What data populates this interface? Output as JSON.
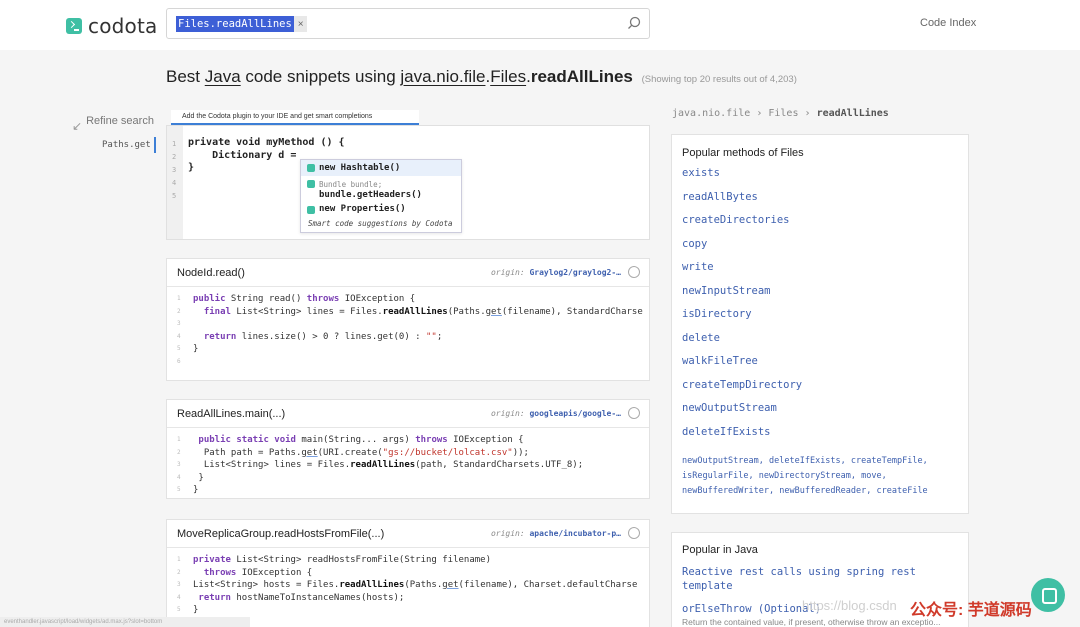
{
  "header": {
    "brand": "codota",
    "search_chip": "Files.readAllLines",
    "chip_close": "×",
    "code_index": "Code Index"
  },
  "page": {
    "title_prefix": "Best ",
    "title_lang": "Java",
    "title_mid": " code snippets using ",
    "title_pkg": "java.nio.file",
    "title_dot1": ".",
    "title_class": "Files",
    "title_dot2": ".",
    "title_method": "readAllLines",
    "results_note": "(Showing top 20 results out of 4,203)"
  },
  "refine": {
    "label": "Refine search",
    "items": [
      "Paths.get"
    ]
  },
  "editor": {
    "plugin_tab": "Add the Codota plugin to your IDE and get smart completions",
    "line_numbers": [
      "1",
      "2",
      "3",
      "4",
      "5"
    ],
    "code": "private void myMethod () {\n    Dictionary d =\n}",
    "suggestions": {
      "s1": "new Hashtable()",
      "s2_hint": "Bundle bundle;",
      "s2": "bundle.getHeaders()",
      "s3": "new Properties()",
      "footer": "Smart code suggestions by Codota"
    }
  },
  "cards": [
    {
      "title": "NodeId.read()",
      "origin_label": "origin:",
      "origin": "Graylog2/graylog2-…"
    },
    {
      "title": "ReadAllLines.main(...)",
      "origin_label": "origin:",
      "origin": "googleapis/google-…"
    },
    {
      "title": "MoveReplicaGroup.readHostsFromFile(...)",
      "origin_label": "origin:",
      "origin": "apache/incubator-p…"
    }
  ],
  "breadcrumb": {
    "pkg": "java.nio.file",
    "sep1": "›",
    "cls": "Files",
    "sep2": "›",
    "method": "readAllLines"
  },
  "popular_methods": {
    "title": "Popular methods of Files",
    "items": [
      "exists",
      "readAllBytes",
      "createDirectories",
      "copy",
      "write",
      "newInputStream",
      "isDirectory",
      "delete",
      "walkFileTree",
      "createTempDirectory",
      "newOutputStream",
      "deleteIfExists"
    ],
    "more": [
      "newOutputStream",
      "deleteIfExists",
      "createTempFile",
      "isRegularFile",
      "newDirectoryStream",
      "move",
      "newBufferedWriter",
      "newBufferedReader",
      "createFile"
    ]
  },
  "popular_java": {
    "title": "Popular in Java",
    "item1": "Reactive rest calls using spring rest template",
    "item2": "orElseThrow (Optional)",
    "item2_desc": "Return the contained value, if present, otherwise throw an exceptio..."
  },
  "overlay": {
    "watermark": "https://blog.csdn",
    "wechat": "公众号: 芋道源码",
    "status": "eventhandler.javascript/load/widgets/ad.max.js?slot=bottom"
  },
  "colors": {
    "brand": "#3fbfa4",
    "link": "#3d5fae",
    "keyword": "#7a3fb3",
    "string": "#c0342b",
    "accent": "#3d7fd6"
  }
}
